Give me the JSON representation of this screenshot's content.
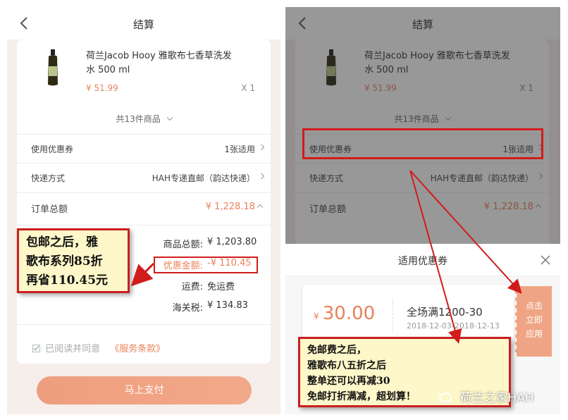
{
  "colors": {
    "accent": "#e8825a",
    "annotation_red": "#d11c1c",
    "note_bg": "#fdf7c9"
  },
  "left": {
    "header": {
      "title": "结算",
      "back_icon": "chevron-left-icon"
    },
    "product": {
      "name_line1": "荷兰Jacob Hooy 雅歌布七香草洗发",
      "name_line2": "水 500 ml",
      "price": "¥ 51.99",
      "qty": "X 1"
    },
    "items_summary": "共13件商品",
    "coupon": {
      "label": "使用优惠券",
      "value": "1张适用"
    },
    "shipping": {
      "label": "快递方式",
      "value": "HAH专递直邮（韵达快递）"
    },
    "order_total": {
      "label": "订单总额",
      "value": "¥ 1,228.18"
    },
    "details": [
      {
        "label": "商品总额:",
        "value": "¥ 1,203.80"
      },
      {
        "label": "优惠金额:",
        "value": "-¥ 110.45"
      },
      {
        "label": "运费:",
        "value": "免运费"
      },
      {
        "label": "海关税:",
        "value": "¥ 134.83"
      }
    ],
    "terms": {
      "prefix": "已阅读并同意",
      "link": "《服务条款》"
    },
    "pay_button": "马上支付",
    "note": [
      "包邮之后，雅",
      "歌布系列85折",
      "再省110.45元"
    ]
  },
  "right": {
    "header": {
      "title": "结算",
      "back_icon": "chevron-left-icon"
    },
    "product": {
      "name_line1": "荷兰Jacob Hooy 雅歌布七香草洗发",
      "name_line2": "水 500 ml",
      "price": "¥ 51.99",
      "qty": "X 1"
    },
    "items_summary": "共13件商品",
    "coupon": {
      "label": "使用优惠券",
      "value": "1张适用"
    },
    "shipping": {
      "label": "快递方式",
      "value": "HAH专递直邮（韵达快递）"
    },
    "order_total": {
      "label": "订单总额",
      "value": "¥ 1,228.18"
    },
    "sheet": {
      "title": "适用优惠券",
      "currency": "¥",
      "amount": "30.00",
      "coupon_name": "全场满1200-30",
      "date_range": "2018-12-03-2018-12-13",
      "apply_button": [
        "点击",
        "立即",
        "应用"
      ]
    },
    "note": [
      "免邮费之后，",
      "雅歌布八五折之后",
      "整单还可以再减30",
      "免邮打折满减，超划算！"
    ],
    "watermark": "荷兰之家HAH"
  }
}
